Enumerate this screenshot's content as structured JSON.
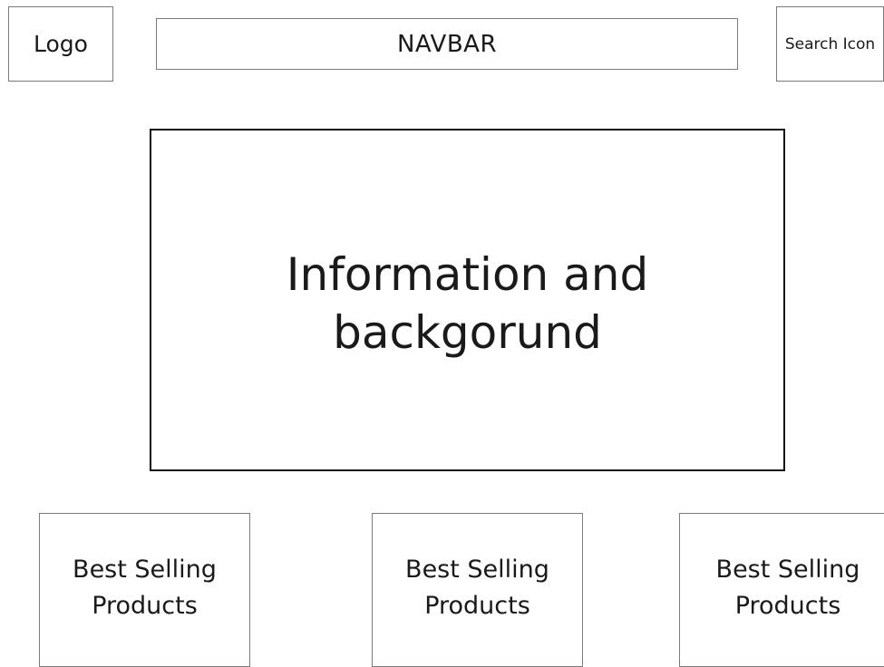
{
  "header": {
    "logo_label": "Logo",
    "navbar_label": "NAVBAR",
    "search_label": "Search Icon"
  },
  "hero": {
    "text": "Information and backgorund"
  },
  "products": [
    {
      "label": "Best Selling Products"
    },
    {
      "label": "Best Selling Products"
    },
    {
      "label": "Best Selling Products"
    }
  ]
}
